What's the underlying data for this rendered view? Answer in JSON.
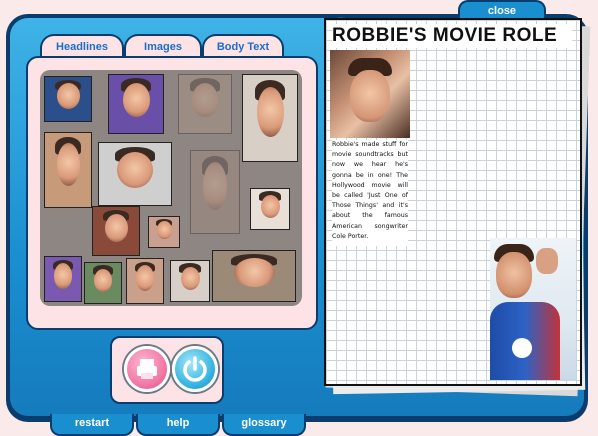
{
  "tabs": [
    {
      "label": "Headlines"
    },
    {
      "label": "Images"
    },
    {
      "label": "Body Text"
    }
  ],
  "bottom_nav": [
    {
      "label": "restart"
    },
    {
      "label": "help"
    },
    {
      "label": "glossary"
    }
  ],
  "close_label": "close",
  "article": {
    "headline": "ROBBIE'S MOVIE ROLE",
    "body": "Robbie's made stuff for movie soundtracks but now we hear he's gonna be in one! The Hollywood movie will be called 'Just One of Those Things' and it's about the famous American songwriter Cole Porter."
  },
  "colors": {
    "frame_blue": "#1a8fd0",
    "frame_dark": "#0a3d6e",
    "panel_pink": "#fde3e6",
    "tab_text": "#1a6ecc",
    "print_button": "#f27aa6",
    "reset_button": "#3ab7e2"
  },
  "icons": {
    "print": "printer-icon",
    "reset": "power-reset-icon"
  }
}
